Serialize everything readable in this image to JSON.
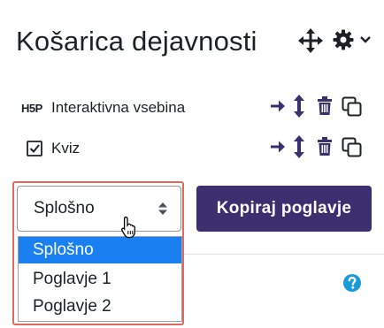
{
  "block": {
    "title": "Košarica dejavnosti"
  },
  "activities": [
    {
      "icon": "h5p-icon",
      "icon_text": "H5P",
      "label": "Interaktivna vsebina"
    },
    {
      "icon": "quiz-checkbox-icon",
      "label": "Kviz"
    }
  ],
  "section_select": {
    "value": "Splošno",
    "options": [
      "Splošno",
      "Poglavje 1",
      "Poglavje 2"
    ],
    "selected_index": 0
  },
  "copy_button": {
    "label": "Kopiraj poglavje"
  },
  "colors": {
    "accent_purple": "#3b2f6f",
    "selected_blue": "#1a7ff0",
    "help_blue": "#1a9ad6",
    "highlight_red": "#e06a5c"
  }
}
